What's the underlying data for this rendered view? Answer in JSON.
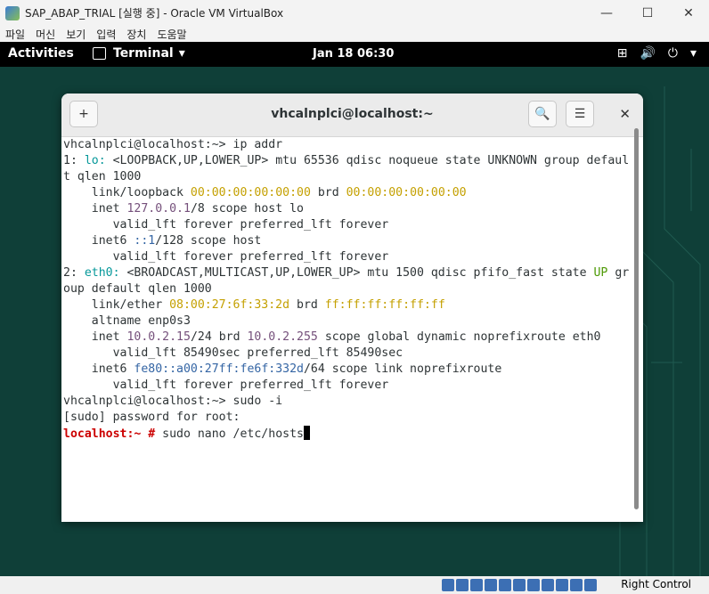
{
  "window": {
    "title": "SAP_ABAP_TRIAL [실행 중] - Oracle VM VirtualBox",
    "minimize": "—",
    "maximize": "☐",
    "close": "✕"
  },
  "menubar": [
    "파일",
    "머신",
    "보기",
    "입력",
    "장치",
    "도움말"
  ],
  "gnome": {
    "activities": "Activities",
    "app_name": "Terminal",
    "app_arrow": "▾",
    "clock": "Jan 18  06:30",
    "tray": {
      "network": "⊞",
      "volume": "🔊",
      "power": "⏻",
      "arrow": "▾"
    }
  },
  "terminal": {
    "title": "vhcalnplci@localhost:~",
    "new_tab_glyph": "+",
    "search_glyph": "🔍",
    "menu_glyph": "☰",
    "close_glyph": "✕",
    "lines": [
      [
        {
          "t": "vhcalnplci@localhost:~> ip addr"
        }
      ],
      [
        {
          "t": "1: "
        },
        {
          "t": "lo:",
          "c": "c-cyan"
        },
        {
          "t": " <LOOPBACK,UP,LOWER_UP> mtu 65536 qdisc noqueue state UNKNOWN group defaul"
        }
      ],
      [
        {
          "t": "t qlen 1000"
        }
      ],
      [
        {
          "t": "    link/loopback "
        },
        {
          "t": "00:00:00:00:00:00",
          "c": "c-yellow"
        },
        {
          "t": " brd "
        },
        {
          "t": "00:00:00:00:00:00",
          "c": "c-yellow"
        }
      ],
      [
        {
          "t": "    inet "
        },
        {
          "t": "127.0.0.1",
          "c": "c-purple"
        },
        {
          "t": "/8 scope host lo"
        }
      ],
      [
        {
          "t": "       valid_lft forever preferred_lft forever"
        }
      ],
      [
        {
          "t": "    inet6 "
        },
        {
          "t": "::1",
          "c": "c-blue"
        },
        {
          "t": "/128 scope host"
        }
      ],
      [
        {
          "t": "       valid_lft forever preferred_lft forever"
        }
      ],
      [
        {
          "t": "2: "
        },
        {
          "t": "eth0:",
          "c": "c-cyan"
        },
        {
          "t": " <BROADCAST,MULTICAST,UP,LOWER_UP> mtu 1500 qdisc pfifo_fast state "
        },
        {
          "t": "UP",
          "c": "c-green"
        },
        {
          "t": " gr"
        }
      ],
      [
        {
          "t": "oup default qlen 1000"
        }
      ],
      [
        {
          "t": "    link/ether "
        },
        {
          "t": "08:00:27:6f:33:2d",
          "c": "c-yellow"
        },
        {
          "t": " brd "
        },
        {
          "t": "ff:ff:ff:ff:ff:ff",
          "c": "c-yellow"
        }
      ],
      [
        {
          "t": "    altname enp0s3"
        }
      ],
      [
        {
          "t": "    inet "
        },
        {
          "t": "10.0.2.15",
          "c": "c-purple"
        },
        {
          "t": "/24 brd "
        },
        {
          "t": "10.0.2.255",
          "c": "c-purple"
        },
        {
          "t": " scope global dynamic noprefixroute eth0"
        }
      ],
      [
        {
          "t": "       valid_lft 85490sec preferred_lft 85490sec"
        }
      ],
      [
        {
          "t": "    inet6 "
        },
        {
          "t": "fe80::a00:27ff:fe6f:332d",
          "c": "c-blue"
        },
        {
          "t": "/64 scope link noprefixroute"
        }
      ],
      [
        {
          "t": "       valid_lft forever preferred_lft forever"
        }
      ],
      [
        {
          "t": "vhcalnplci@localhost:~> sudo -i"
        }
      ],
      [
        {
          "t": "[sudo] password for root:"
        }
      ],
      [
        {
          "t": "localhost:~ #",
          "c": "c-red"
        },
        {
          "t": " sudo nano /etc/hosts"
        },
        {
          "cursor": true
        }
      ]
    ]
  },
  "statusbar": {
    "host_key": "Right Control"
  }
}
